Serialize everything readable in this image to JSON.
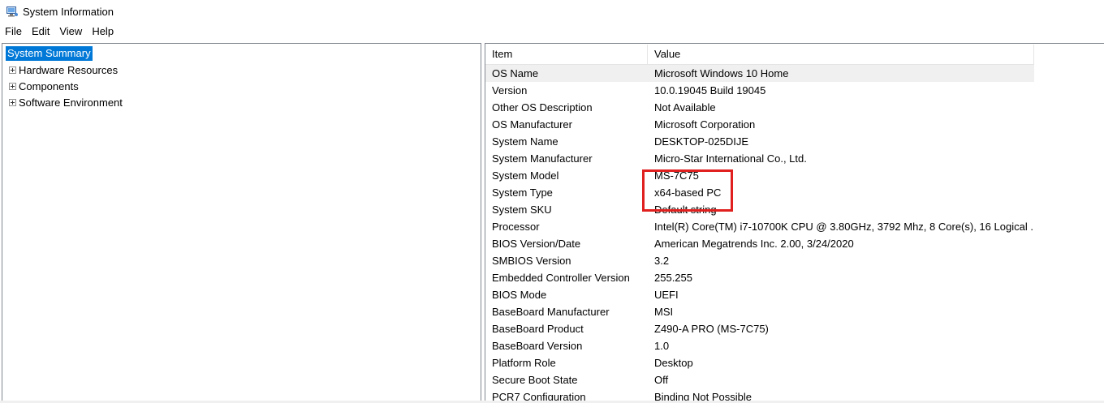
{
  "window": {
    "title": "System Information"
  },
  "menu": {
    "items": [
      "File",
      "Edit",
      "View",
      "Help"
    ]
  },
  "tree": {
    "selected": "System Summary",
    "nodes": [
      "Hardware Resources",
      "Components",
      "Software Environment"
    ]
  },
  "list": {
    "headers": {
      "item": "Item",
      "value": "Value"
    },
    "rows": [
      {
        "item": "OS Name",
        "value": "Microsoft Windows 10 Home"
      },
      {
        "item": "Version",
        "value": "10.0.19045 Build 19045"
      },
      {
        "item": "Other OS Description",
        "value": "Not Available"
      },
      {
        "item": "OS Manufacturer",
        "value": "Microsoft Corporation"
      },
      {
        "item": "System Name",
        "value": "DESKTOP-025DIJE"
      },
      {
        "item": "System Manufacturer",
        "value": "Micro-Star International Co., Ltd."
      },
      {
        "item": "System Model",
        "value": "MS-7C75"
      },
      {
        "item": "System Type",
        "value": "x64-based PC"
      },
      {
        "item": "System SKU",
        "value": "Default string"
      },
      {
        "item": "Processor",
        "value": "Intel(R) Core(TM) i7-10700K CPU @ 3.80GHz, 3792 Mhz, 8 Core(s), 16 Logical ..."
      },
      {
        "item": "BIOS Version/Date",
        "value": "American Megatrends Inc. 2.00, 3/24/2020"
      },
      {
        "item": "SMBIOS Version",
        "value": "3.2"
      },
      {
        "item": "Embedded Controller Version",
        "value": "255.255"
      },
      {
        "item": "BIOS Mode",
        "value": "UEFI"
      },
      {
        "item": "BaseBoard Manufacturer",
        "value": "MSI"
      },
      {
        "item": "BaseBoard Product",
        "value": "Z490-A PRO (MS-7C75)"
      },
      {
        "item": "BaseBoard Version",
        "value": "1.0"
      },
      {
        "item": "Platform Role",
        "value": "Desktop"
      },
      {
        "item": "Secure Boot State",
        "value": "Off"
      },
      {
        "item": "PCR7 Configuration",
        "value": "Binding Not Possible"
      }
    ]
  },
  "colors": {
    "selection": "#0078d7",
    "highlight_row": "#f0f0f0",
    "annotation": "#e0201f"
  }
}
